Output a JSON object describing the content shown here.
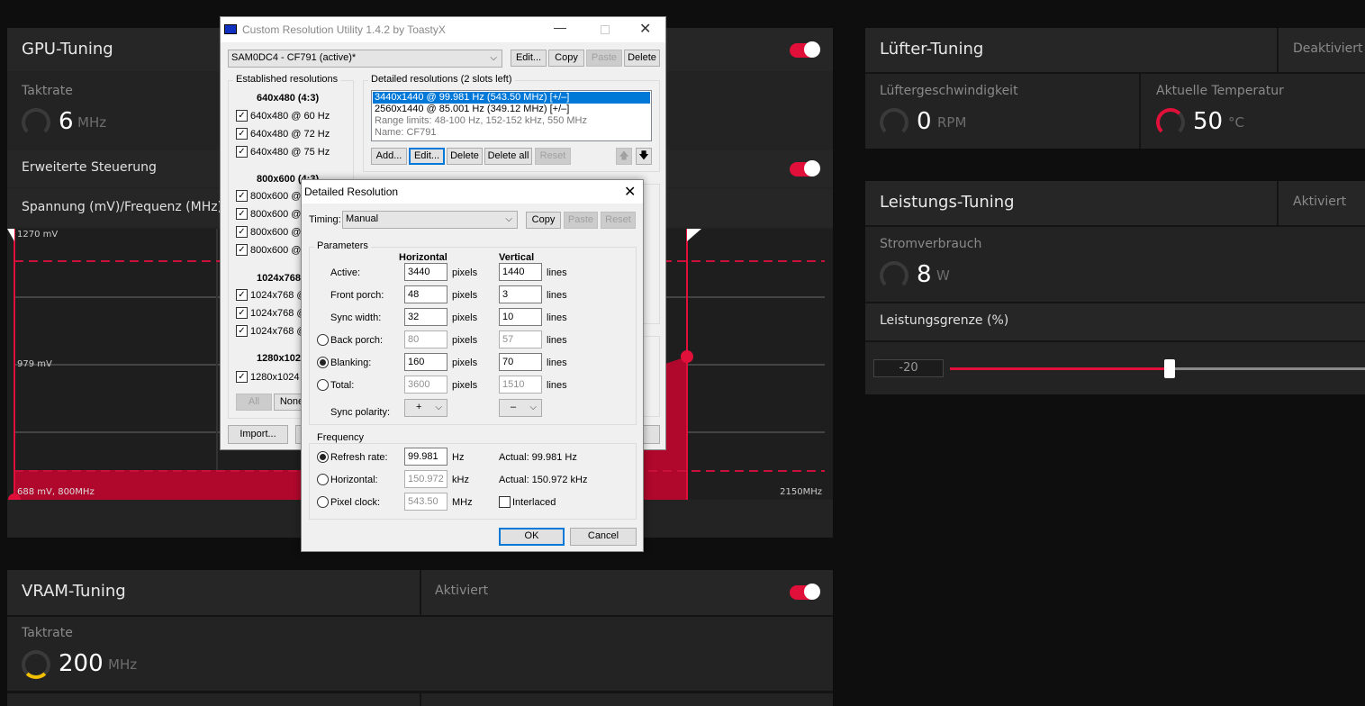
{
  "amd": {
    "gpu": {
      "title": "GPU-Tuning",
      "clock_label": "Taktrate",
      "clock_value": "6",
      "clock_unit": "MHz",
      "advanced": "Erweiterte Steuerung",
      "vf_label": "Spannung (mV)/Frequenz (MHz)",
      "enabled": true
    },
    "chart": {
      "y_top": "1270 mV",
      "y_mid": "979 mV",
      "min_point": "688 mV, 800MHz",
      "x_max": "2150MHz"
    },
    "vram": {
      "title": "VRAM-Tuning",
      "status": "Aktiviert",
      "clock_label": "Taktrate",
      "clock_value": "200",
      "clock_unit": "MHz",
      "enabled": true
    },
    "fan": {
      "title": "Lüfter-Tuning",
      "status": "Deaktiviert",
      "speed_label": "Lüftergeschwindigkeit",
      "speed_value": "0",
      "speed_unit": "RPM",
      "temp_label": "Aktuelle Temperatur",
      "temp_value": "50",
      "temp_unit": "°C"
    },
    "power": {
      "title": "Leistungs-Tuning",
      "status": "Aktiviert",
      "draw_label": "Stromverbrauch",
      "draw_value": "8",
      "draw_unit": "W",
      "limit_label": "Leistungsgrenze (%)",
      "limit_value": "-20"
    },
    "colors": {
      "accent": "#e0103a",
      "panel": "#232323"
    }
  },
  "cru": {
    "title": "Custom Resolution Utility 1.4.2 by ToastyX",
    "monitor": "SAM0DC4 - CF791 (active)*",
    "top_buttons": [
      "Edit...",
      "Copy",
      "Paste",
      "Delete"
    ],
    "established_label": "Established resolutions",
    "groups": [
      {
        "header": "640x480 (4:3)",
        "items": [
          "640x480 @ 60 Hz",
          "640x480 @ 72 Hz",
          "640x480 @ 75 Hz"
        ]
      },
      {
        "header": "800x600 (4:3)",
        "items": [
          "800x600 @",
          "800x600 @",
          "800x600 @",
          "800x600 @"
        ]
      },
      {
        "header": "1024x768",
        "items": [
          "1024x768 @",
          "1024x768 @",
          "1024x768 @"
        ]
      },
      {
        "header": "1280x102",
        "items": [
          "1280x1024"
        ]
      }
    ],
    "all": "All",
    "none": "None",
    "import": "Import...",
    "detailed_label": "Detailed resolutions (2 slots left)",
    "detailed_items": [
      "3440x1440 @ 99.981 Hz (543.50 MHz) [+/–]",
      "2560x1440 @ 85.001 Hz (349.12 MHz) [+/–]",
      "Range limits: 48-100 Hz, 152-152 kHz, 550 MHz",
      "Name: CF791"
    ],
    "detailed_buttons": [
      "Add...",
      "Edit...",
      "Delete",
      "Delete all",
      "Reset"
    ]
  },
  "dialog": {
    "title": "Detailed Resolution",
    "timing_label": "Timing:",
    "timing_value": "Manual",
    "buttons": [
      "Copy",
      "Paste",
      "Reset"
    ],
    "params_label": "Parameters",
    "h_header": "Horizontal",
    "v_header": "Vertical",
    "rows": [
      {
        "label": "Active:",
        "h": "3440",
        "v": "1440",
        "radio": null
      },
      {
        "label": "Front porch:",
        "h": "48",
        "v": "3",
        "radio": null
      },
      {
        "label": "Sync width:",
        "h": "32",
        "v": "10",
        "radio": null
      },
      {
        "label": "Back porch:",
        "h": "80",
        "v": "57",
        "radio": false
      },
      {
        "label": "Blanking:",
        "h": "160",
        "v": "70",
        "radio": true
      },
      {
        "label": "Total:",
        "h": "3600",
        "v": "1510",
        "radio": false
      }
    ],
    "h_unit": "pixels",
    "v_unit": "lines",
    "sync_label": "Sync polarity:",
    "sync_h": "+",
    "sync_v": "–",
    "freq_label": "Frequency",
    "refresh_label": "Refresh rate:",
    "refresh_value": "99.981",
    "refresh_unit": "Hz",
    "refresh_actual": "Actual: 99.981 Hz",
    "horiz_label": "Horizontal:",
    "horiz_value": "150.972",
    "horiz_unit": "kHz",
    "horiz_actual": "Actual: 150.972 kHz",
    "pclk_label": "Pixel clock:",
    "pclk_value": "543.50",
    "pclk_unit": "MHz",
    "interlaced": "Interlaced",
    "ok": "OK",
    "cancel": "Cancel"
  }
}
